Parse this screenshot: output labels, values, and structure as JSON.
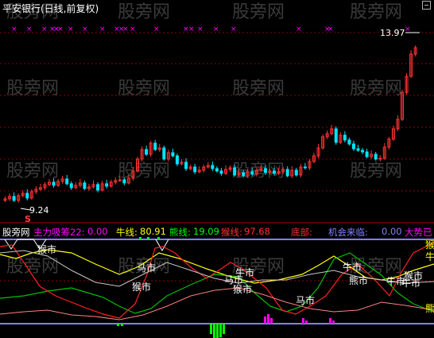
{
  "window": {
    "title": "平安银行(日线,前复权)",
    "corner_button": "minimize"
  },
  "watermark": "股旁网",
  "price_chart": {
    "high_label": "13.97",
    "low_label": "9.24",
    "s_marker": "S"
  },
  "indicator_bar": {
    "source": "股旁网",
    "main_label": "主力吸筹22:",
    "main_value": "0.00",
    "bull_label": "牛线:",
    "bull_value": "80.91",
    "bear_label": "熊线:",
    "bear_value": "19.09",
    "monkey_label": "猴线:",
    "monkey_value": "97.68",
    "bottom_label": "底部:",
    "chance_label": "机会来临:",
    "chance_value": "0.00",
    "trend_label": "大势已"
  },
  "indicator_annotations": [
    "猴市",
    "马市",
    "猴市",
    "牛市",
    "马市",
    "猴市",
    "牛市",
    "熊市",
    "马市",
    "牛市",
    "猴市",
    "牛市"
  ],
  "right_edge_labels": [
    "猴",
    "牛",
    "熊"
  ],
  "colors": {
    "up": "#ff3232",
    "down": "#00e4ff",
    "grid": "#8b0000",
    "bull": "#ffff00",
    "bear": "#00c000",
    "monkey": "#ff2020",
    "horse": "#ffffff",
    "baseline": "#8080ff",
    "signal": "#ff00ff",
    "volume_bar": "#00ff00"
  }
}
